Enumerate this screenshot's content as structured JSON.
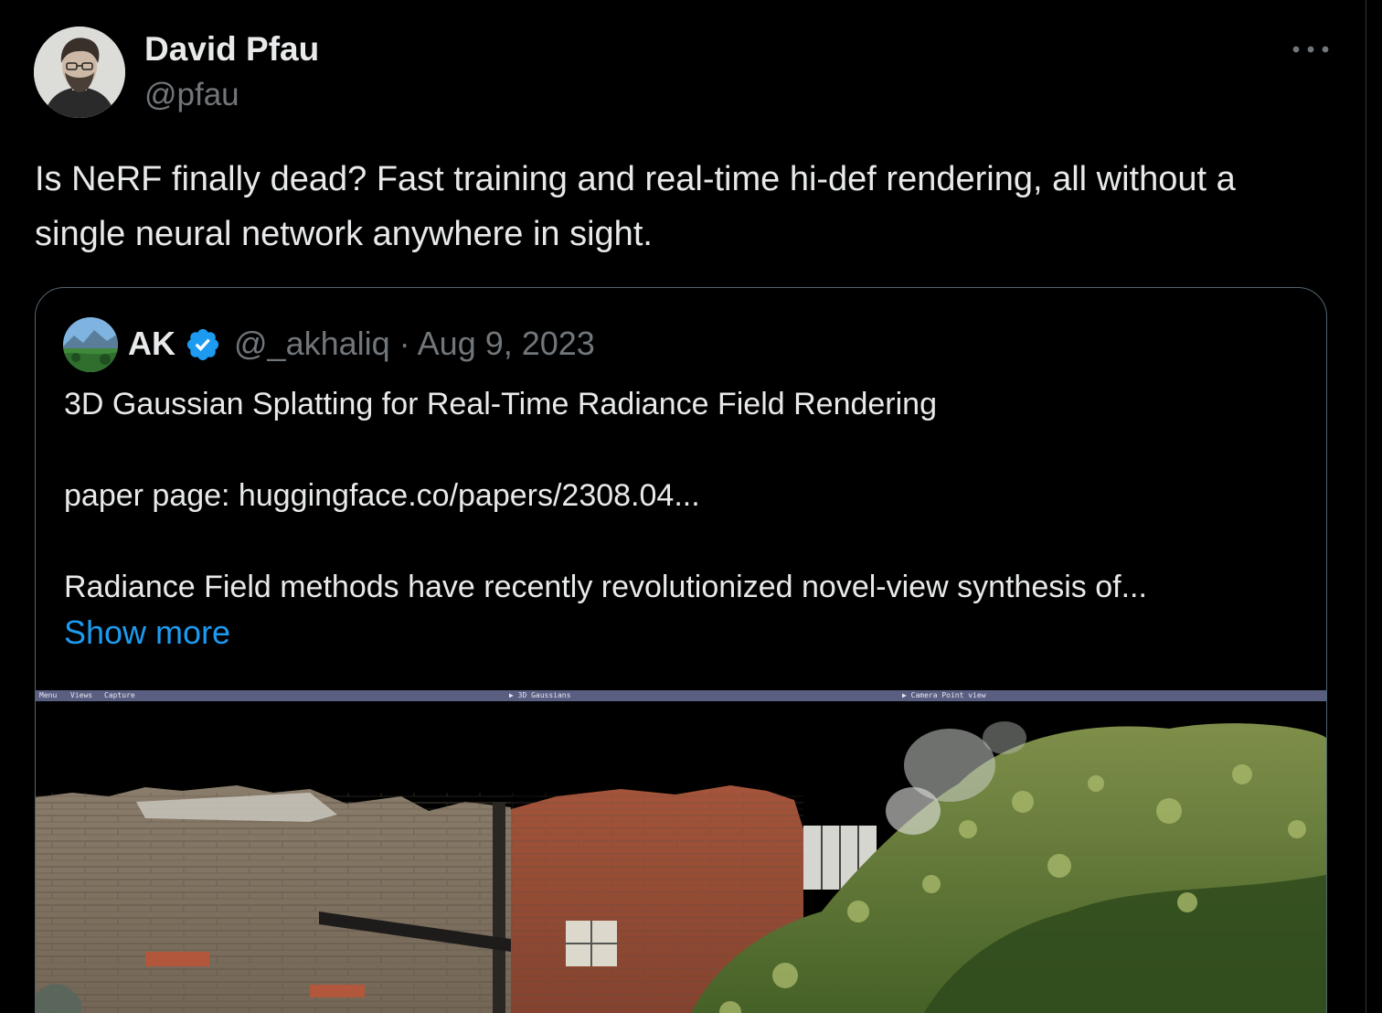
{
  "tweet": {
    "author_name": "David Pfau",
    "author_handle": "@pfau",
    "avatar_icon": "person-avatar",
    "more_icon": "more-horizontal-icon",
    "text": "Is NeRF finally dead? Fast training and real-time hi-def rendering, all without a single neural network anywhere in sight."
  },
  "quote": {
    "name": "AK",
    "verified_icon": "verified-badge-icon",
    "handle": "@_akhaliq",
    "date": "Aug 9, 2023",
    "meta": "@_akhaliq · Aug 9, 2023",
    "title_line": "3D Gaussian Splatting for Real-Time Radiance Field Rendering",
    "paper_line": "paper page: huggingface.co/papers/2308.04...",
    "abstract_line": "Radiance Field methods have recently revolutionized novel-view synthesis of...",
    "show_more": "Show more",
    "media": {
      "menu_items": [
        "Menu",
        "Views",
        "Capture"
      ],
      "panel_1": "▶ 3D Gaussians",
      "panel_2": "▶ Camera Point view"
    }
  },
  "colors": {
    "background": "#000000",
    "text_primary": "#e7e9ea",
    "text_secondary": "#71767b",
    "link": "#1d9bf0",
    "border": "#536471",
    "verified": "#1d9bf0"
  }
}
